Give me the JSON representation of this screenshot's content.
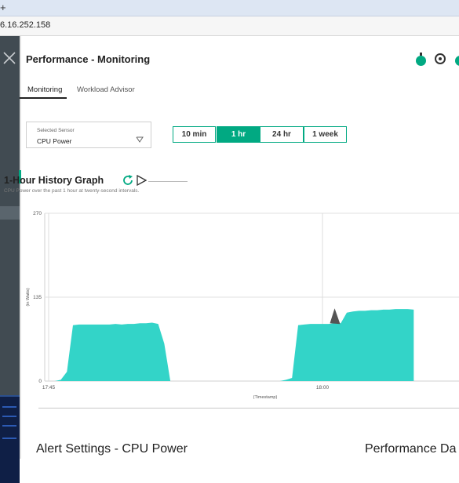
{
  "browser": {
    "tab_glyph": "+",
    "url": "6.16.252.158"
  },
  "sidebar": {
    "close_icon": "close-icon"
  },
  "header": {
    "title": "Performance - Monitoring",
    "icons": [
      "power-status-icon",
      "target-icon",
      "power-status-icon"
    ],
    "status_color": "#01a982"
  },
  "tabs": [
    {
      "label": "Monitoring",
      "active": true
    },
    {
      "label": "Workload Advisor",
      "active": false
    }
  ],
  "sensor": {
    "label": "Selected Sensor",
    "value": "CPU Power"
  },
  "ranges": [
    {
      "label": "10 min",
      "active": false
    },
    {
      "label": "1 hr",
      "active": true
    },
    {
      "label": "24 hr",
      "active": false
    },
    {
      "label": "1 week",
      "active": false
    }
  ],
  "graph": {
    "title": "1-Hour History Graph",
    "subtitle": "CPU Power over the past 1 hour at twenty-second intervals."
  },
  "chart_data": {
    "type": "area",
    "xlabel": "(Timestamp)",
    "ylabel": "(in Watts)",
    "ylim": [
      0,
      270
    ],
    "yticks": [
      "270",
      "135",
      "0"
    ],
    "xticks": [
      "17:45",
      "18:00"
    ],
    "grid": true,
    "colors": {
      "fill": "#33d4c8",
      "spike": "#555555"
    },
    "x": [
      "17:45:00",
      "17:45:20",
      "17:45:40",
      "17:46:00",
      "17:46:20",
      "17:46:40",
      "17:47:00",
      "17:47:20",
      "17:47:40",
      "17:48:00",
      "17:48:20",
      "17:48:40",
      "17:49:00",
      "17:49:20",
      "17:49:40",
      "17:50:00",
      "17:50:20",
      "17:50:40",
      "17:51:00",
      "17:51:20",
      "17:51:40",
      "17:52:00",
      "17:52:20",
      "17:52:40",
      "17:53:00",
      "17:53:20",
      "17:53:40",
      "17:54:00",
      "17:54:20",
      "17:54:40",
      "17:55:00",
      "17:55:20",
      "17:55:40",
      "17:56:00",
      "17:56:20",
      "17:56:40",
      "17:57:00",
      "17:57:20",
      "17:57:40",
      "17:58:00",
      "17:58:20",
      "17:58:40",
      "17:59:00",
      "17:59:20",
      "17:59:40",
      "18:00:00",
      "18:00:20",
      "18:00:40",
      "18:01:00",
      "18:01:20",
      "18:01:40",
      "18:02:00",
      "18:02:20",
      "18:02:40",
      "18:03:00",
      "18:03:20",
      "18:03:40",
      "18:04:00",
      "18:04:20",
      "18:04:40",
      "18:05:00"
    ],
    "values": [
      0,
      0,
      2,
      15,
      90,
      91,
      91,
      91,
      91,
      91,
      91,
      92,
      91,
      92,
      92,
      93,
      93,
      94,
      92,
      60,
      0,
      0,
      0,
      0,
      0,
      0,
      0,
      0,
      0,
      0,
      0,
      0,
      0,
      0,
      0,
      0,
      0,
      0,
      0,
      2,
      5,
      90,
      91,
      92,
      92,
      92,
      92,
      93,
      93,
      110,
      112,
      113,
      113,
      114,
      114,
      115,
      115,
      116,
      116,
      116,
      115
    ],
    "spike": {
      "x": "18:00:40",
      "value": 117
    }
  },
  "sections": [
    {
      "title": "Alert Settings - CPU Power"
    },
    {
      "title": "Performance Da"
    }
  ]
}
